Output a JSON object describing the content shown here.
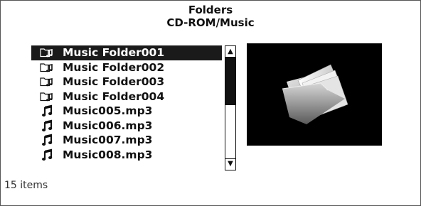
{
  "header": {
    "title": "Folders",
    "path": "CD-ROM/Music"
  },
  "list": {
    "items": [
      {
        "label": "Music Folder001",
        "icon": "folder-music-icon",
        "selected": true
      },
      {
        "label": "Music Folder002",
        "icon": "folder-music-icon",
        "selected": false
      },
      {
        "label": "Music Folder003",
        "icon": "folder-music-icon",
        "selected": false
      },
      {
        "label": "Music Folder004",
        "icon": "folder-music-icon",
        "selected": false
      },
      {
        "label": "Music005.mp3",
        "icon": "music-note-icon",
        "selected": false
      },
      {
        "label": "Music006.mp3",
        "icon": "music-note-icon",
        "selected": false
      },
      {
        "label": "Music007.mp3",
        "icon": "music-note-icon",
        "selected": false
      },
      {
        "label": "Music008.mp3",
        "icon": "music-note-icon",
        "selected": false
      }
    ]
  },
  "scrollbar": {
    "up_icon": "arrow-up-icon",
    "down_icon": "arrow-down-icon",
    "up_glyph": "▲",
    "down_glyph": "▼"
  },
  "preview": {
    "icon": "open-folder-icon"
  },
  "status": {
    "count_text": "15 items"
  },
  "colors": {
    "selection_bg": "#1a1a1a",
    "selection_text": "#ffffff",
    "text": "#111111",
    "preview_bg": "#000000"
  }
}
